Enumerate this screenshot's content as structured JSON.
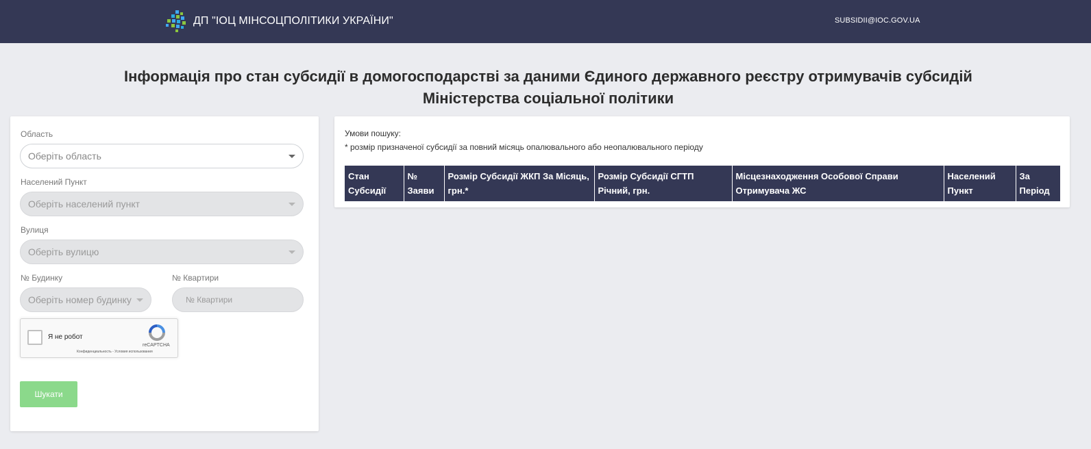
{
  "header": {
    "org_name": "ДП \"ІОЦ МІНСОЦПОЛІТИКИ УКРАЇНИ\"",
    "email": "SUBSIDII@IOC.GOV.UA",
    "logo_icon": "pixel-grid-logo-icon"
  },
  "page": {
    "title_line1": "Інформація про стан субсидії в домогосподарстві за даними Єдиного державного реєстру отримувачів субсидій",
    "title_line2": "Міністерства соціальної політики"
  },
  "form": {
    "region_label": "Область",
    "region_placeholder": "Оберіть область",
    "settlement_label": "Населений Пункт",
    "settlement_placeholder": "Оберіть населений пункт",
    "street_label": "Вулиця",
    "street_placeholder": "Оберіть вулицю",
    "house_label": "№ Будинку",
    "house_placeholder": "Оберіть номер будинку",
    "apartment_label": "№ Квартири",
    "apartment_placeholder": "№ Квартири",
    "captcha_label": "Я не робот",
    "captcha_brand": "reCAPTCHA",
    "captcha_links": "Конфиденциальность - Условия использования",
    "search_button": "Шукати"
  },
  "results": {
    "conditions_title": "Умови пошуку:",
    "conditions_note": "* розмір призначеної субсидії за повний місяць опалювального або неопалювального періоду",
    "columns": [
      "Стан Субсидії",
      "№ Заяви",
      "Розмір Субсидії ЖКП За Місяць, грн.*",
      "Розмір Субсидії СГТП Річний, грн.",
      "Місцезнаходження Особової Справи Отримувача ЖС",
      "Населений Пункт",
      "За Період"
    ]
  },
  "colors": {
    "header_bg": "#343855",
    "page_bg": "#ebecf0",
    "button_green": "#8bd98b"
  }
}
